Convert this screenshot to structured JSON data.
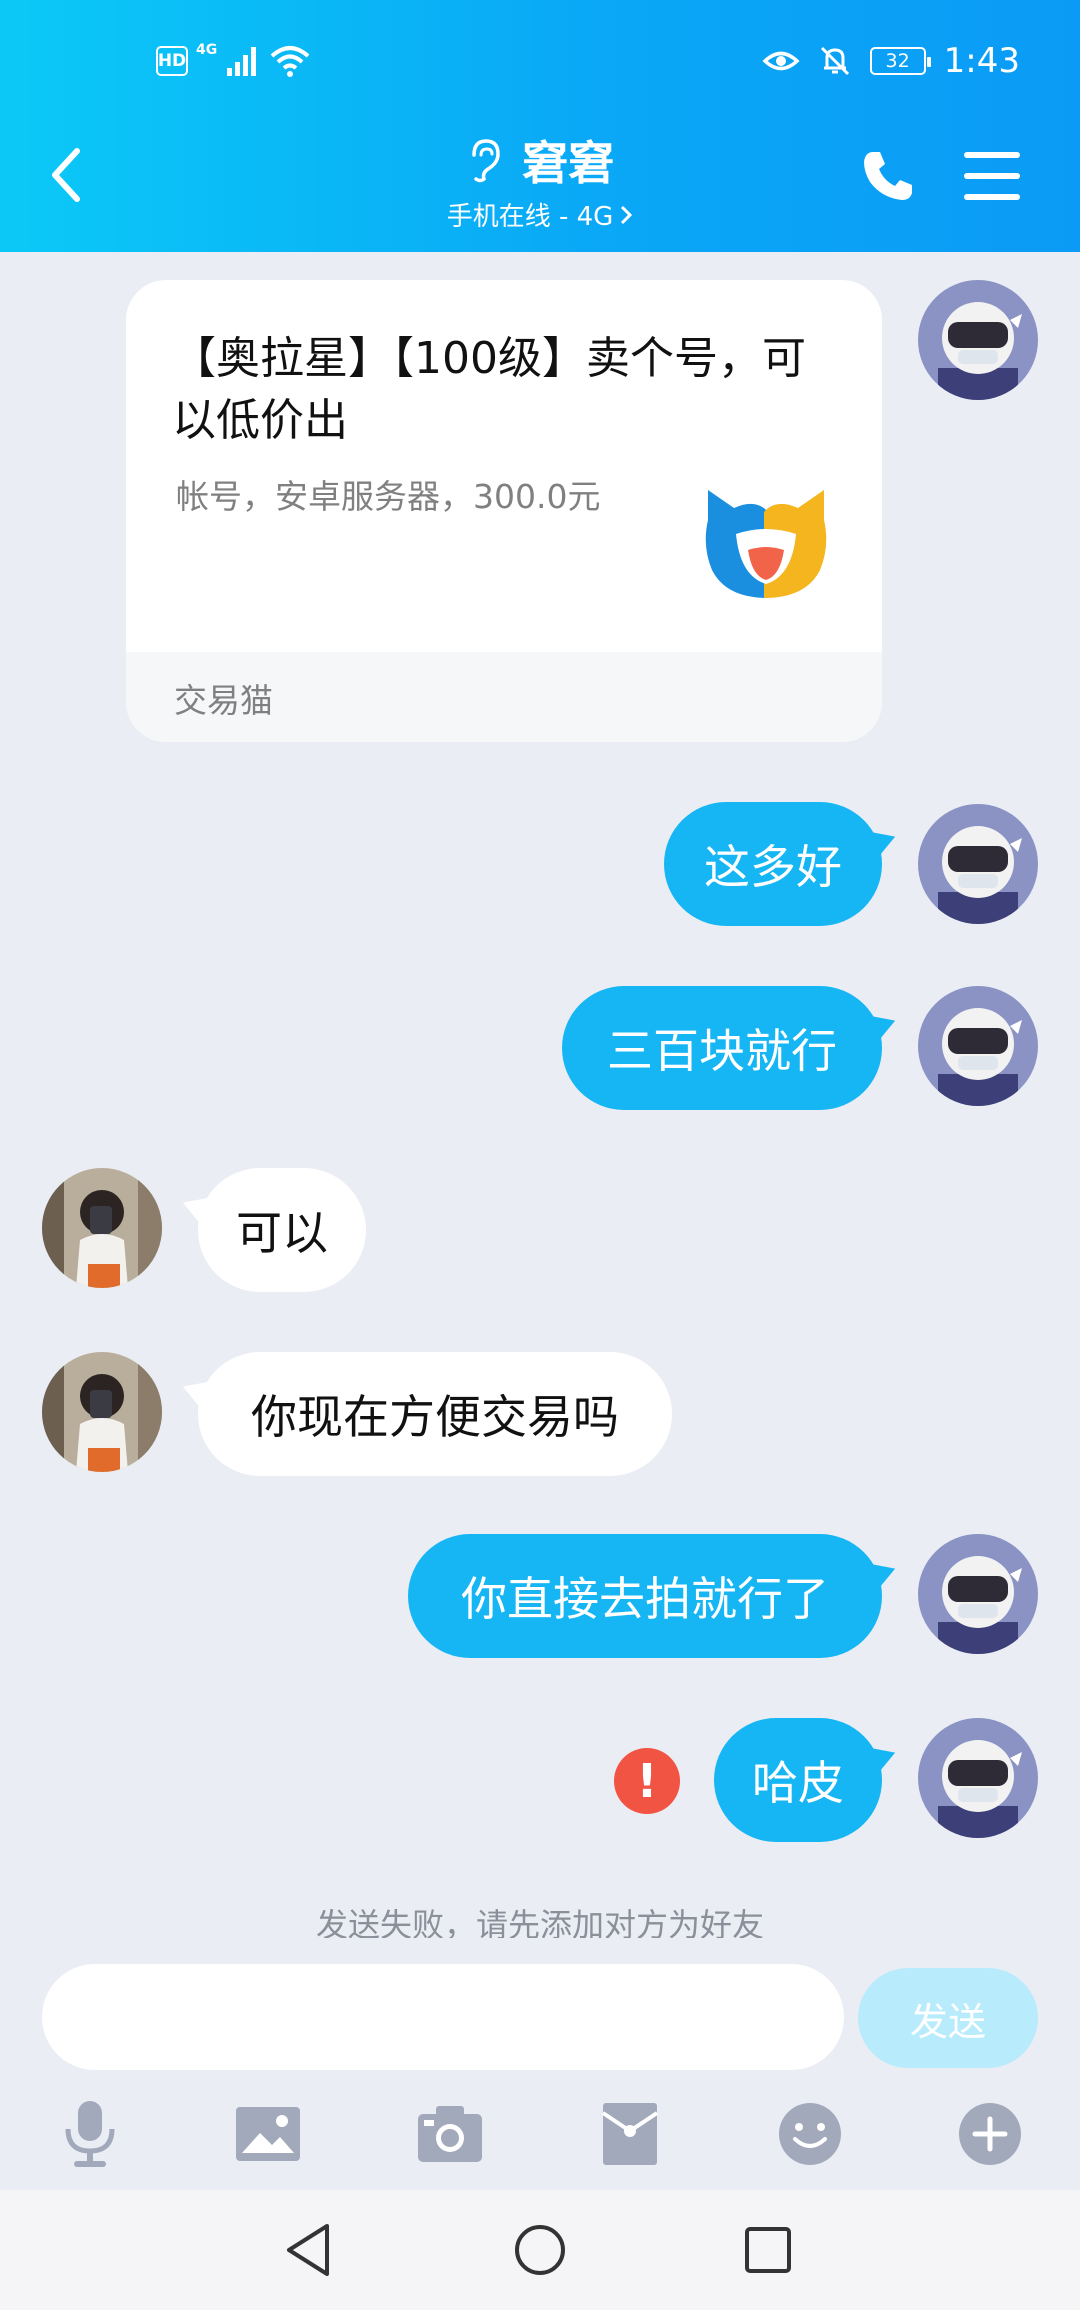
{
  "status_bar": {
    "hd": "HD",
    "network": "4G",
    "battery": "32",
    "time": "1:43"
  },
  "header": {
    "title": "窘窘",
    "subtitle": "手机在线 - 4G"
  },
  "card": {
    "title": "【奥拉星】【100级】卖个号，可以低价出",
    "description": "帐号，安卓服务器，300.0元",
    "source": "交易猫"
  },
  "messages": [
    {
      "direction": "out",
      "text": "这多好"
    },
    {
      "direction": "out",
      "text": "三百块就行"
    },
    {
      "direction": "in",
      "text": "可以"
    },
    {
      "direction": "in",
      "text": "你现在方便交易吗"
    },
    {
      "direction": "out",
      "text": "你直接去拍就行了"
    },
    {
      "direction": "out",
      "text": "哈皮",
      "status": "failed"
    }
  ],
  "error_badge": "!",
  "notice": "发送失败，请先添加对方为好友",
  "composer": {
    "input_value": "",
    "send_label": "发送"
  },
  "toolbar_icons": [
    "microphone-icon",
    "image-icon",
    "camera-icon",
    "red-packet-icon",
    "emoji-icon",
    "plus-icon"
  ],
  "colors": {
    "header_start": "#0bc9f7",
    "header_end": "#0b9bf6",
    "outgoing_bubble": "#16b6f5",
    "incoming_bubble": "#ffffff",
    "background": "#eaedf4",
    "error": "#f25443",
    "send_disabled": "#b8ecfc"
  }
}
